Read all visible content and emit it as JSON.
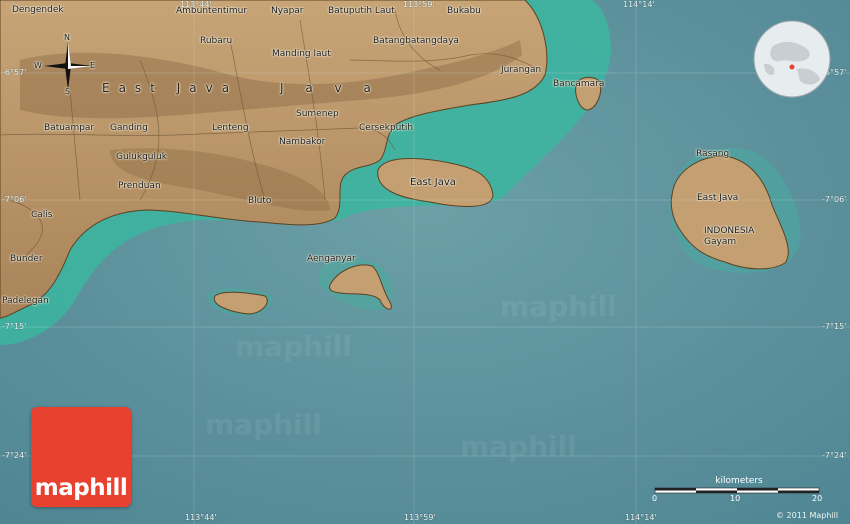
{
  "map": {
    "region_label": "East Java",
    "places": [
      {
        "key": "dengendek",
        "name": "Dengendek"
      },
      {
        "key": "ambuntentimur",
        "name": "Ambuntentimur"
      },
      {
        "key": "nyapar",
        "name": "Nyapar"
      },
      {
        "key": "batuputih_laut",
        "name": "Batuputih Laut"
      },
      {
        "key": "bukabu",
        "name": "Bukabu"
      },
      {
        "key": "rubaru",
        "name": "Rubaru"
      },
      {
        "key": "manding_laut",
        "name": "Manding laut"
      },
      {
        "key": "batangbatangdaya",
        "name": "Batangbatangdaya"
      },
      {
        "key": "jurangan",
        "name": "Jurangan"
      },
      {
        "key": "bancamara",
        "name": "Bancamara"
      },
      {
        "key": "sumenep",
        "name": "Sumenep"
      },
      {
        "key": "batuampar",
        "name": "Batuampar"
      },
      {
        "key": "ganding",
        "name": "Ganding"
      },
      {
        "key": "lenteng",
        "name": "Lenteng"
      },
      {
        "key": "cersekputih",
        "name": "Cersekputih"
      },
      {
        "key": "nambakor",
        "name": "Nambakor"
      },
      {
        "key": "guluk_guluk",
        "name": "Gulukguluk"
      },
      {
        "key": "prenduan",
        "name": "Prenduan"
      },
      {
        "key": "bluto",
        "name": "Bluto"
      },
      {
        "key": "calis",
        "name": "Calis"
      },
      {
        "key": "bunder",
        "name": "Bunder"
      },
      {
        "key": "padelegan",
        "name": "Padelegan"
      },
      {
        "key": "aenganyar",
        "name": "Aenganyar"
      },
      {
        "key": "rasang",
        "name": "Rasang"
      },
      {
        "key": "indonesia",
        "name": "INDONESIA"
      },
      {
        "key": "gayam",
        "name": "Gayam"
      }
    ],
    "island_labels": {
      "poteran": "East Java",
      "sapudi": "East Java"
    },
    "coords": {
      "top_lon_1": "113°44'",
      "top_lon_2": "113°59'",
      "top_lon_3": "114°14'",
      "bottom_lon_1": "113°44'",
      "bottom_lon_2": "113°59'",
      "bottom_lon_3": "114°14'",
      "left_lat_1": "-6°57'",
      "left_lat_2": "-7°06'",
      "left_lat_3": "-7°15'",
      "left_lat_4": "-7°24'",
      "right_lat_1": "-6°57'",
      "right_lat_2": "-7°06'",
      "right_lat_3": "-7°15'",
      "right_lat_4": "-7°24'"
    },
    "compass": {
      "n": "N",
      "s": "S",
      "e": "E",
      "w": "W"
    },
    "watermark": "maphill"
  },
  "logo": {
    "text": "maphill",
    "color": "#e8412f"
  },
  "scale": {
    "title": "kilometers",
    "ticks": [
      "0",
      "10",
      "20"
    ]
  },
  "copyright": "© 2011 Maphill",
  "colors": {
    "sea": "#5d8f9a",
    "shallow": "#3fbfa5",
    "land": "#b89265",
    "relief": "#8a6a44"
  }
}
